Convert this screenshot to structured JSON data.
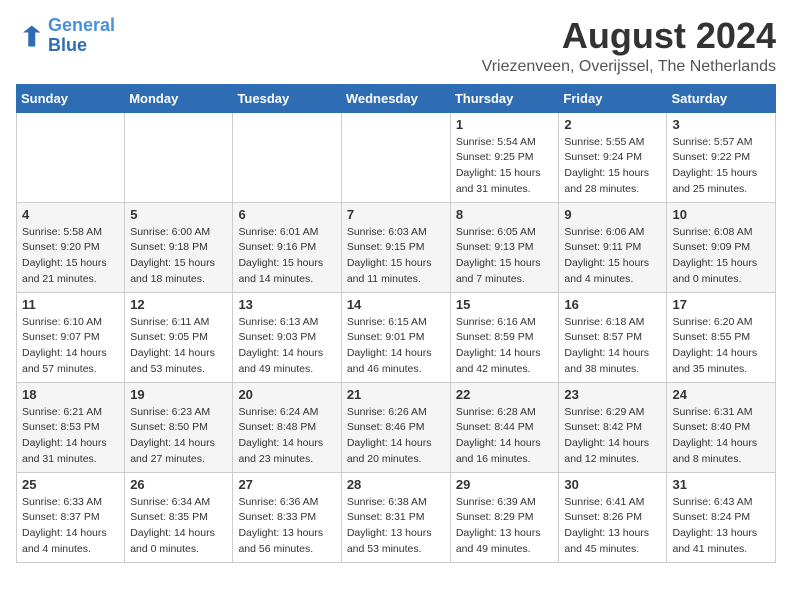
{
  "logo": {
    "line1": "General",
    "line2": "Blue"
  },
  "title": "August 2024",
  "subtitle": "Vriezenveen, Overijssel, The Netherlands",
  "days_of_week": [
    "Sunday",
    "Monday",
    "Tuesday",
    "Wednesday",
    "Thursday",
    "Friday",
    "Saturday"
  ],
  "weeks": [
    [
      {
        "day": "",
        "info": ""
      },
      {
        "day": "",
        "info": ""
      },
      {
        "day": "",
        "info": ""
      },
      {
        "day": "",
        "info": ""
      },
      {
        "day": "1",
        "info": "Sunrise: 5:54 AM\nSunset: 9:25 PM\nDaylight: 15 hours\nand 31 minutes."
      },
      {
        "day": "2",
        "info": "Sunrise: 5:55 AM\nSunset: 9:24 PM\nDaylight: 15 hours\nand 28 minutes."
      },
      {
        "day": "3",
        "info": "Sunrise: 5:57 AM\nSunset: 9:22 PM\nDaylight: 15 hours\nand 25 minutes."
      }
    ],
    [
      {
        "day": "4",
        "info": "Sunrise: 5:58 AM\nSunset: 9:20 PM\nDaylight: 15 hours\nand 21 minutes."
      },
      {
        "day": "5",
        "info": "Sunrise: 6:00 AM\nSunset: 9:18 PM\nDaylight: 15 hours\nand 18 minutes."
      },
      {
        "day": "6",
        "info": "Sunrise: 6:01 AM\nSunset: 9:16 PM\nDaylight: 15 hours\nand 14 minutes."
      },
      {
        "day": "7",
        "info": "Sunrise: 6:03 AM\nSunset: 9:15 PM\nDaylight: 15 hours\nand 11 minutes."
      },
      {
        "day": "8",
        "info": "Sunrise: 6:05 AM\nSunset: 9:13 PM\nDaylight: 15 hours\nand 7 minutes."
      },
      {
        "day": "9",
        "info": "Sunrise: 6:06 AM\nSunset: 9:11 PM\nDaylight: 15 hours\nand 4 minutes."
      },
      {
        "day": "10",
        "info": "Sunrise: 6:08 AM\nSunset: 9:09 PM\nDaylight: 15 hours\nand 0 minutes."
      }
    ],
    [
      {
        "day": "11",
        "info": "Sunrise: 6:10 AM\nSunset: 9:07 PM\nDaylight: 14 hours\nand 57 minutes."
      },
      {
        "day": "12",
        "info": "Sunrise: 6:11 AM\nSunset: 9:05 PM\nDaylight: 14 hours\nand 53 minutes."
      },
      {
        "day": "13",
        "info": "Sunrise: 6:13 AM\nSunset: 9:03 PM\nDaylight: 14 hours\nand 49 minutes."
      },
      {
        "day": "14",
        "info": "Sunrise: 6:15 AM\nSunset: 9:01 PM\nDaylight: 14 hours\nand 46 minutes."
      },
      {
        "day": "15",
        "info": "Sunrise: 6:16 AM\nSunset: 8:59 PM\nDaylight: 14 hours\nand 42 minutes."
      },
      {
        "day": "16",
        "info": "Sunrise: 6:18 AM\nSunset: 8:57 PM\nDaylight: 14 hours\nand 38 minutes."
      },
      {
        "day": "17",
        "info": "Sunrise: 6:20 AM\nSunset: 8:55 PM\nDaylight: 14 hours\nand 35 minutes."
      }
    ],
    [
      {
        "day": "18",
        "info": "Sunrise: 6:21 AM\nSunset: 8:53 PM\nDaylight: 14 hours\nand 31 minutes."
      },
      {
        "day": "19",
        "info": "Sunrise: 6:23 AM\nSunset: 8:50 PM\nDaylight: 14 hours\nand 27 minutes."
      },
      {
        "day": "20",
        "info": "Sunrise: 6:24 AM\nSunset: 8:48 PM\nDaylight: 14 hours\nand 23 minutes."
      },
      {
        "day": "21",
        "info": "Sunrise: 6:26 AM\nSunset: 8:46 PM\nDaylight: 14 hours\nand 20 minutes."
      },
      {
        "day": "22",
        "info": "Sunrise: 6:28 AM\nSunset: 8:44 PM\nDaylight: 14 hours\nand 16 minutes."
      },
      {
        "day": "23",
        "info": "Sunrise: 6:29 AM\nSunset: 8:42 PM\nDaylight: 14 hours\nand 12 minutes."
      },
      {
        "day": "24",
        "info": "Sunrise: 6:31 AM\nSunset: 8:40 PM\nDaylight: 14 hours\nand 8 minutes."
      }
    ],
    [
      {
        "day": "25",
        "info": "Sunrise: 6:33 AM\nSunset: 8:37 PM\nDaylight: 14 hours\nand 4 minutes."
      },
      {
        "day": "26",
        "info": "Sunrise: 6:34 AM\nSunset: 8:35 PM\nDaylight: 14 hours\nand 0 minutes."
      },
      {
        "day": "27",
        "info": "Sunrise: 6:36 AM\nSunset: 8:33 PM\nDaylight: 13 hours\nand 56 minutes."
      },
      {
        "day": "28",
        "info": "Sunrise: 6:38 AM\nSunset: 8:31 PM\nDaylight: 13 hours\nand 53 minutes."
      },
      {
        "day": "29",
        "info": "Sunrise: 6:39 AM\nSunset: 8:29 PM\nDaylight: 13 hours\nand 49 minutes."
      },
      {
        "day": "30",
        "info": "Sunrise: 6:41 AM\nSunset: 8:26 PM\nDaylight: 13 hours\nand 45 minutes."
      },
      {
        "day": "31",
        "info": "Sunrise: 6:43 AM\nSunset: 8:24 PM\nDaylight: 13 hours\nand 41 minutes."
      }
    ]
  ]
}
